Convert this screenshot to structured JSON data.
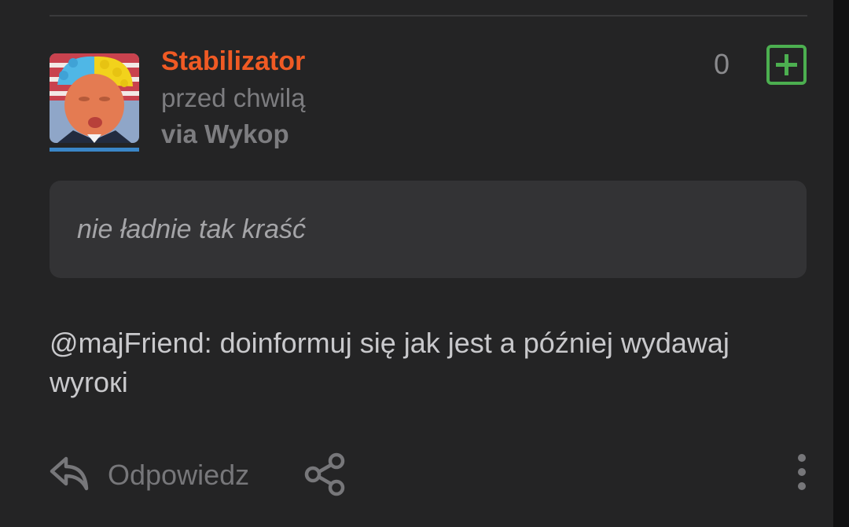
{
  "post": {
    "author": "Stabilizator",
    "timestamp": "przed chwilą",
    "via": "via Wykop",
    "vote_count": "0",
    "quote": "nie ładnie tak kraść",
    "mention": "@majFriend:",
    "comment": " doinformuj się jak jest a później wydawaj wyroкi"
  },
  "actions": {
    "reply_label": "Odpowiedz"
  },
  "icons": {
    "avatar": "avatar",
    "plus": "plus-icon",
    "reply": "reply-icon",
    "share": "share-icon",
    "more": "more-vertical-icon"
  },
  "colors": {
    "background": "#242425",
    "author": "#f05a24",
    "muted": "#7d7d80",
    "quote_bg": "#333335",
    "plus_green": "#4caf50",
    "avatar_bar": "#3a86c8"
  }
}
